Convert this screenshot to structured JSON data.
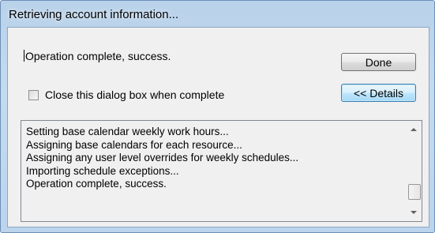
{
  "window": {
    "title": "Retrieving account information..."
  },
  "status": {
    "text": "Operation complete, success."
  },
  "buttons": {
    "done_label": "Done",
    "details_label": "<< Details"
  },
  "checkbox": {
    "label": "Close this dialog box when complete",
    "checked": false
  },
  "log": {
    "lines": [
      "Setting base calendar weekly work hours...",
      "Assigning base calendars for each resource...",
      "Assigning any user level overrides for weekly schedules...",
      "Importing schedule exceptions...",
      "Operation complete, success."
    ]
  },
  "scrollbar": {
    "position": 1.0
  }
}
